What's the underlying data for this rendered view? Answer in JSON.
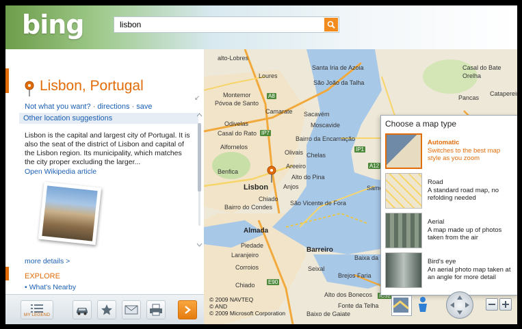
{
  "header": {
    "logo": "bing",
    "search_value": "lisbon"
  },
  "location": {
    "title": "Lisbon, Portugal",
    "link_not_what": "Not what you want?",
    "link_sep": "·",
    "link_directions": "directions",
    "link_save": "save",
    "other_suggestions": "Other location suggestions",
    "description": "Lisbon is the capital and largest city of Portugal. It is also the seat of the district of Lisbon and capital of the Lisbon region. Its municipality, which matches the city proper excluding the larger...",
    "wiki_link": "Open Wikipedia article",
    "more_details": "more details >",
    "explore_heading": "EXPLORE",
    "whats_nearby": "• What's Nearby"
  },
  "toolbar": {
    "legend_label": "MY LEGEND",
    "icons": [
      "legend-icon",
      "car-icon",
      "star-icon",
      "mail-icon",
      "print-icon",
      "chevron-right-icon"
    ]
  },
  "map": {
    "labels": {
      "alto_dos_lobos": "alto-Lobres",
      "loures": "Loures",
      "santa_iria": "Santa Iria de Azoia",
      "casal_bate": "Casal do Bate",
      "orelha": "Orelha",
      "sao_joao_talha": "São João da Talha",
      "pancas": "Pancas",
      "catapereiro": "Catapereiro",
      "montemor": "Montemor",
      "povoa": "Póvoa de Santo",
      "a8": "A8",
      "camarate": "Camarate",
      "sacavem": "Sacavém",
      "odivelas": "Odivelas",
      "moscavide": "Moscavide",
      "casal_rato": "Casal do Rato",
      "ip7": "IP7",
      "bairro_encarnacao": "Bairro da Encarnação",
      "alfornelos": "Alfornelos",
      "olivais": "Olivais",
      "chelas": "Chelas",
      "ip1": "IP1",
      "a12": "A12",
      "benfica": "Benfica",
      "areeiro": "Areeiro",
      "alto_pina": "Alto do Pina",
      "lisbon": "Lisbon",
      "anjos": "Anjos",
      "samouco": "Samouco",
      "chiado": "Chiado",
      "sao_vicente": "São Vicente de Fora",
      "bairro_condes": "Bairro do Condes",
      "almada": "Almada",
      "piedade": "Piedade",
      "barreiro": "Barreiro",
      "laranjeiro": "Laranjeiro",
      "seixal": "Seixal",
      "baixa_banheira": "Baixa da Banheira",
      "corroios": "Corroios",
      "brejos_faria": "Brejos Faria",
      "e90": "E90",
      "chiado_small": "Chiado",
      "ic32": "IC32",
      "alto_bonecos": "Alto dos Bonecos",
      "fonte_telha": "Fonte da Telha",
      "baixa_pinhal": "Baixo de Gaiate"
    },
    "copyright_lines": [
      "© 2009 NAVTEQ",
      "© AND",
      "© 2009 Microsoft Corporation"
    ]
  },
  "map_type_panel": {
    "title": "Choose a map type",
    "items": [
      {
        "name": "Automatic",
        "desc": "Switches to the best map style as you zoom"
      },
      {
        "name": "Road",
        "desc": "A standard road map, no refolding needed"
      },
      {
        "name": "Aerial",
        "desc": "A map made up of photos taken from the air"
      },
      {
        "name": "Bird's eye",
        "desc": "An aerial photo map taken at an angle for more detail"
      }
    ]
  },
  "colors": {
    "accent_orange": "#e36c0a",
    "link_blue": "#1a5fb4",
    "water": "#a8c8e8",
    "land": "#eee8d8"
  }
}
